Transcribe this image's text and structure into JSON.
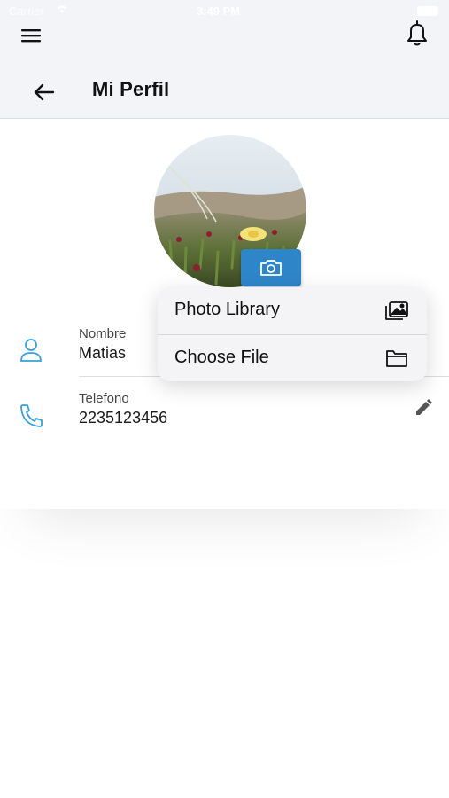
{
  "status_bar": {
    "carrier": "Carrier",
    "time": "3:49 PM"
  },
  "header": {
    "menu_icon": "hamburger-menu-icon",
    "notification_icon": "bell-icon",
    "back_icon": "arrow-left-icon",
    "title": "Mi Perfil"
  },
  "profile": {
    "camera_icon": "camera-icon",
    "fields": [
      {
        "label": "Nombre",
        "value": "Matias",
        "icon": "person-icon"
      },
      {
        "label": "Telefono",
        "value": "2235123456",
        "icon": "phone-icon"
      }
    ],
    "edit_icon": "pencil-icon"
  },
  "photo_menu": {
    "items": [
      {
        "label": "Photo Library",
        "icon": "photos-icon"
      },
      {
        "label": "Choose File",
        "icon": "folder-icon"
      }
    ]
  },
  "colors": {
    "accent": "#2e86c9",
    "icon_blue": "#3aa0d8",
    "header_bg": "#f3f4f8"
  }
}
